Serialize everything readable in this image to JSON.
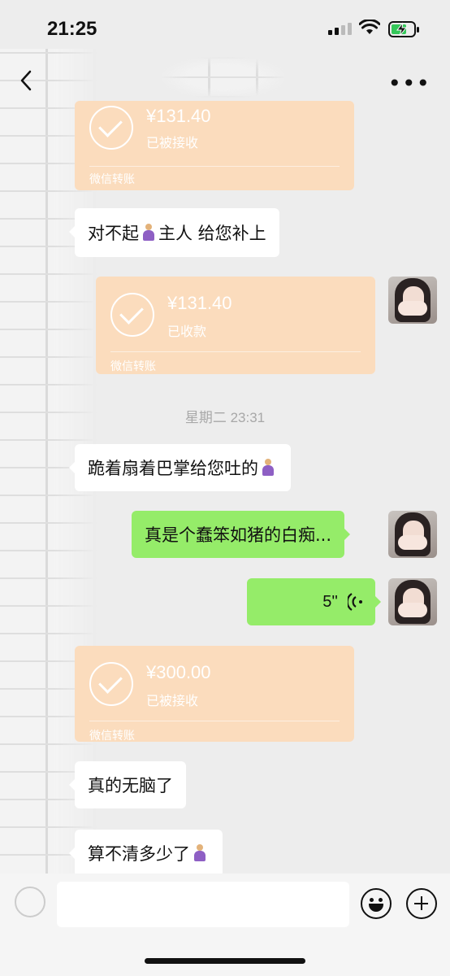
{
  "status_bar": {
    "time": "21:25"
  },
  "nav": {
    "back_icon": "chevron-left-icon",
    "more_label": "•••"
  },
  "messages": {
    "transfer_1": {
      "amount": "¥131.40",
      "status": "已被接收",
      "label": "微信转账"
    },
    "text_1": {
      "before": "对不起",
      "after": "主人 给您补上"
    },
    "transfer_2": {
      "amount": "¥131.40",
      "status": "已收款",
      "label": "微信转账"
    },
    "timestamp": "星期二 23:31",
    "text_2": {
      "text": "跪着扇着巴掌给您吐的"
    },
    "text_3": {
      "text": "真是个蠢笨如猪的白痴..."
    },
    "voice": {
      "duration": "5''"
    },
    "transfer_3": {
      "amount": "¥300.00",
      "status": "已被接收",
      "label": "微信转账"
    },
    "text_4": {
      "text": "真的无脑了"
    },
    "text_5": {
      "text": "算不清多少了"
    }
  },
  "icons": {
    "kneel": "person-kneeling-emoji",
    "voice": "voice-wave-icon",
    "emoji": "smiley-icon",
    "plus": "plus-circle-icon"
  },
  "colors": {
    "transfer_bg": "#fbdcbd",
    "sent_bubble": "#95ec69",
    "received_bubble": "#ffffff",
    "chat_bg": "#ededed"
  }
}
